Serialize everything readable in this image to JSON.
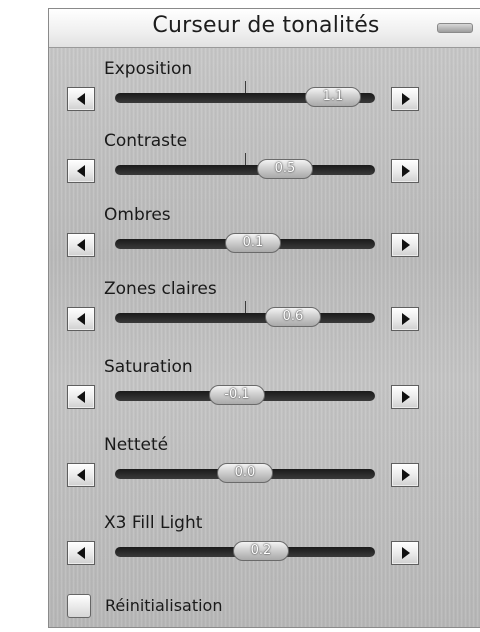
{
  "panel": {
    "title": "Curseur de tonalités"
  },
  "sliders": [
    {
      "label": "Exposition",
      "value_text": "1.1",
      "value": 1.1
    },
    {
      "label": "Contraste",
      "value_text": "0.5",
      "value": 0.5
    },
    {
      "label": "Ombres",
      "value_text": "0.1",
      "value": 0.1
    },
    {
      "label": "Zones claires",
      "value_text": "0.6",
      "value": 0.6
    },
    {
      "label": "Saturation",
      "value_text": "-0.1",
      "value": -0.1
    },
    {
      "label": "Netteté",
      "value_text": "0.0",
      "value": 0.0
    },
    {
      "label": "X3 Fill Light",
      "value_text": "0.2",
      "value": 0.2
    }
  ],
  "reset": {
    "label": "Réinitialisation",
    "checked": false
  },
  "icons": {
    "collapse": "minimize-icon",
    "left": "left-arrow-icon",
    "right": "right-arrow-icon"
  }
}
